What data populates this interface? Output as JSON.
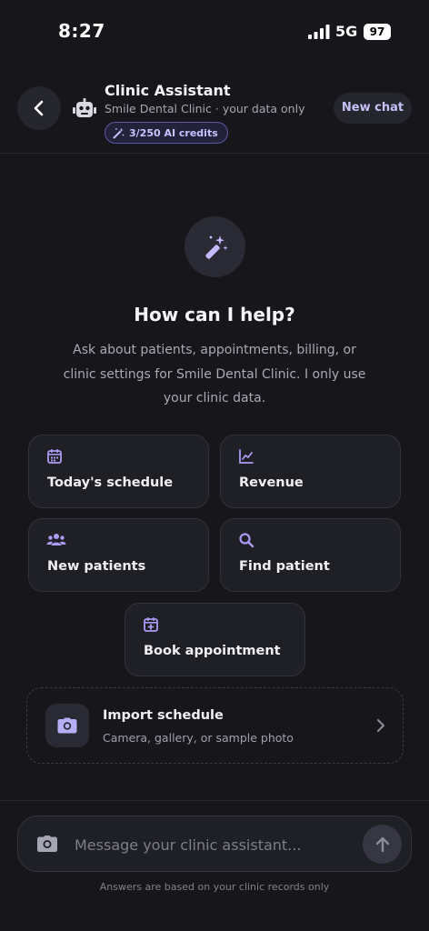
{
  "status_bar": {
    "time": "8:27",
    "network": "5G",
    "battery": "97"
  },
  "header": {
    "title": "Clinic Assistant",
    "subtitle": "Smile Dental Clinic · your data only",
    "credits": "3/250 AI credits",
    "new_chat_label": "New chat"
  },
  "hero": {
    "title": "How can I help?",
    "description": "Ask about patients, appointments, billing, or clinic settings for Smile Dental Clinic. I only use your clinic data."
  },
  "quick_actions": [
    {
      "label": "Today's schedule",
      "icon": "calendar-icon"
    },
    {
      "label": "Revenue",
      "icon": "chart-line-icon"
    },
    {
      "label": "New patients",
      "icon": "users-icon"
    },
    {
      "label": "Find patient",
      "icon": "search-icon"
    },
    {
      "label": "Book appointment",
      "icon": "calendar-plus-icon"
    }
  ],
  "import": {
    "title": "Import schedule",
    "subtitle": "Camera, gallery, or sample photo",
    "icon": "camera-icon"
  },
  "composer": {
    "placeholder": "Message your clinic assistant...",
    "value": ""
  },
  "footnote": "Answers are based on your clinic records only",
  "colors": {
    "background": "#16161b",
    "card": "#1f1f26",
    "accent": "#a99cf5",
    "accent_border": "#5d56a8"
  }
}
